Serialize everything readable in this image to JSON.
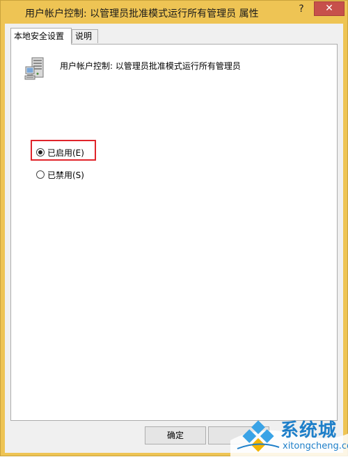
{
  "window": {
    "title": "用户帐户控制: 以管理员批准模式运行所有管理员 属性",
    "help_label": "?",
    "close_label": "✕"
  },
  "tabs": [
    {
      "label": "本地安全设置"
    },
    {
      "label": "说明"
    }
  ],
  "policy": {
    "icon": "server-computer-icon",
    "title": "用户帐户控制: 以管理员批准模式运行所有管理员"
  },
  "options": {
    "enabled_label": "已启用(E)",
    "disabled_label": "已禁用(S)",
    "selected": "enabled"
  },
  "buttons": {
    "ok_label": "确定"
  },
  "watermark": {
    "logo_icon": "windows-logo-icon",
    "brand": "系统城",
    "url": "xitongcheng.com"
  },
  "colors": {
    "title_bar": "#eec454",
    "close_button": "#c7504b",
    "highlight": "#e0242a",
    "watermark_blue": "#1e7fc9"
  }
}
